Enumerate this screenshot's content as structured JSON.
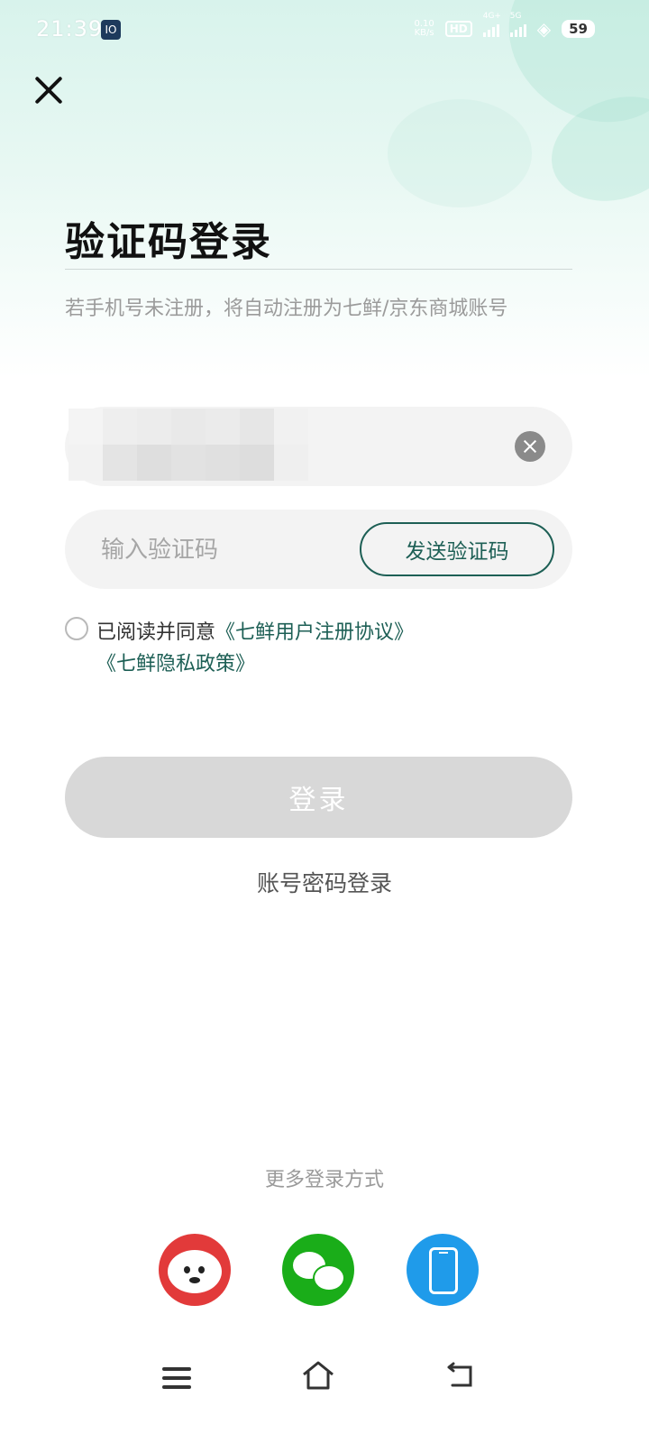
{
  "status_bar": {
    "time": "21:39",
    "app_icon_label": "IO",
    "net_speed_top": "0.10",
    "net_speed_unit": "KB/s",
    "hd_label": "HD",
    "signal1_label": "4G+",
    "signal2_label": "5G",
    "battery": "59"
  },
  "page": {
    "title": "验证码登录",
    "subtitle": "若手机号未注册，将自动注册为七鲜/京东商城账号"
  },
  "form": {
    "code_placeholder": "输入验证码",
    "send_code_label": "发送验证码",
    "agree_prefix": "已阅读并同意",
    "agreement_link": "《七鲜用户注册协议》",
    "privacy_link": "《七鲜隐私政策》",
    "login_label": "登录",
    "password_login_label": "账号密码登录"
  },
  "more_login": {
    "title": "更多登录方式",
    "options": [
      "jd-login",
      "wechat-login",
      "phone-login"
    ]
  },
  "colors": {
    "accent": "#1d5f55",
    "jd_red": "#e23a3a",
    "wechat_green": "#1aad19",
    "phone_blue": "#1f9bea",
    "disabled_button": "#d8d8d8"
  }
}
